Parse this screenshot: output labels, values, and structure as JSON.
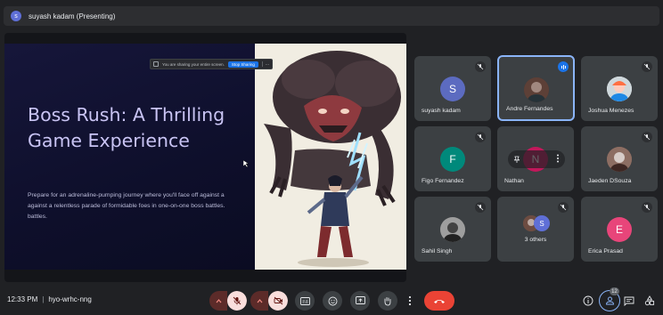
{
  "presenter_bar": {
    "initial": "s",
    "title": "suyash kadam (Presenting)"
  },
  "share_notice": {
    "text": "You are sharing your entire screen.",
    "stop_label": "Stop Sharing",
    "more": "..."
  },
  "slide": {
    "title": "Boss Rush: A Thrilling Game Experience",
    "body": "Prepare for an adrenaline-pumping journey where you'll face off against a against a relentless parade of formidable foes in one-on-one boss battles. battles."
  },
  "participants": [
    {
      "name": "suyash kadam",
      "initial": "S",
      "color": "#5c6bc0",
      "muted": true
    },
    {
      "name": "Andre Fernandes",
      "photo": true,
      "speaking": true
    },
    {
      "name": "Joshua Menezes",
      "photo": true,
      "muted": true
    },
    {
      "name": "Figo Fernandez",
      "initial": "F",
      "color": "#00897b",
      "muted": true
    },
    {
      "name": "Nathan",
      "initial": "N",
      "color": "#c2185b",
      "hovered": true
    },
    {
      "name": "Jaeden DSouza",
      "photo": true,
      "muted": true
    },
    {
      "name": "Sahil Singh",
      "photo": true,
      "muted": true
    },
    {
      "name": "3 others",
      "initial": "S",
      "muted": true
    },
    {
      "name": "Erica Prasad",
      "initial": "E",
      "color": "#e8457a",
      "muted": true
    }
  ],
  "meeting": {
    "time": "12:33 PM",
    "separator": "|",
    "code": "hyo-wrhc-nng"
  },
  "controls": {
    "mic": "mic-off-icon",
    "camera": "camera-off-icon",
    "captions": "captions-icon",
    "emoji": "emoji-icon",
    "present": "present-icon",
    "raise_hand": "hand-icon",
    "more": "more-vert-icon",
    "end_call": "call-end-icon"
  },
  "right_controls": {
    "people_count": "12"
  },
  "colors": {
    "bg": "#202124",
    "tile": "#3c4043",
    "accent": "#8ab4f8",
    "end_call": "#ea4335",
    "mic_off_bg": "#f9dedc"
  }
}
